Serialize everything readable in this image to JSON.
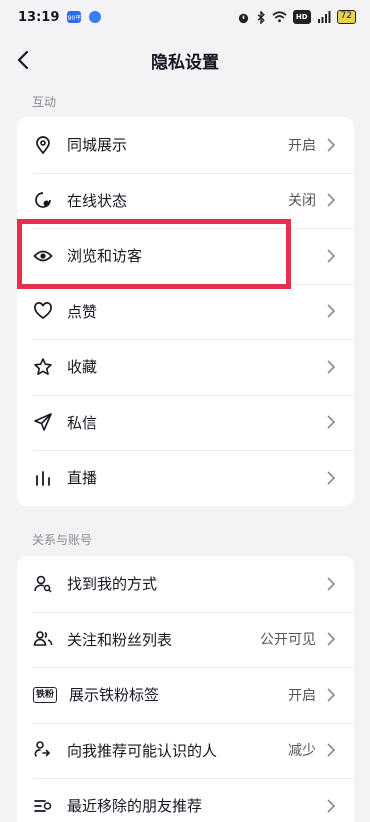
{
  "status_bar": {
    "time": "13:19",
    "app_badge": "90平",
    "right_label": "HD",
    "battery": "72"
  },
  "nav": {
    "title": "隐私设置"
  },
  "sections": [
    {
      "header": "互动",
      "items": [
        {
          "label": "同城展示",
          "value": "开启",
          "icon": "location-pin-icon"
        },
        {
          "label": "在线状态",
          "value": "关闭",
          "icon": "online-status-icon"
        },
        {
          "label": "浏览和访客",
          "value": "",
          "icon": "eye-icon"
        },
        {
          "label": "点赞",
          "value": "",
          "icon": "heart-icon"
        },
        {
          "label": "收藏",
          "value": "",
          "icon": "star-icon"
        },
        {
          "label": "私信",
          "value": "",
          "icon": "paper-plane-icon"
        },
        {
          "label": "直播",
          "value": "",
          "icon": "live-bars-icon"
        }
      ]
    },
    {
      "header": "关系与账号",
      "items": [
        {
          "label": "找到我的方式",
          "value": "",
          "icon": "person-search-icon"
        },
        {
          "label": "关注和粉丝列表",
          "value": "公开可见",
          "icon": "people-icon"
        },
        {
          "label": "展示铁粉标签",
          "value": "开启",
          "icon": "fan-badge-icon",
          "badge_text": "铁粉"
        },
        {
          "label": "向我推荐可能认识的人",
          "value": "减少",
          "icon": "recommend-person-icon"
        },
        {
          "label": "最近移除的朋友推荐",
          "value": "",
          "icon": "removed-list-icon"
        }
      ]
    }
  ],
  "colors": {
    "highlight": "#e4304b",
    "background": "#f3f3f5"
  }
}
